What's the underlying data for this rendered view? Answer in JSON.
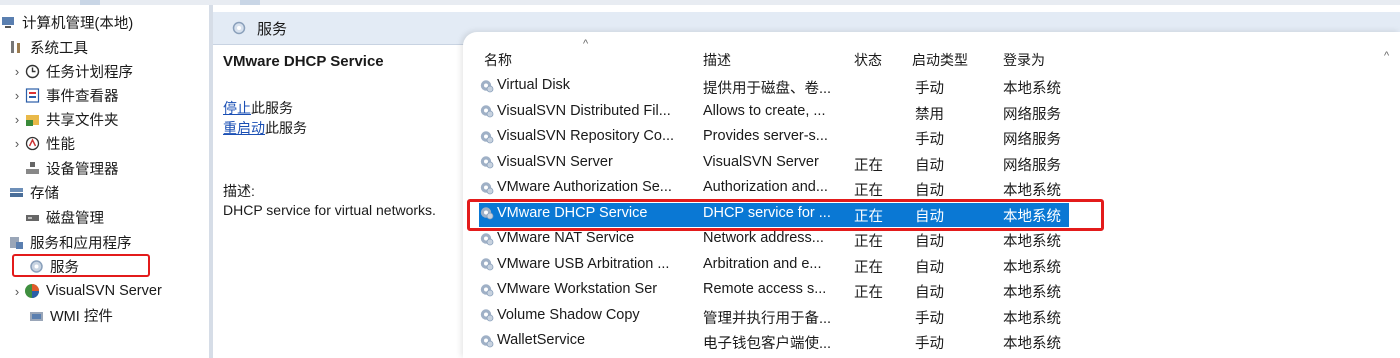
{
  "tree": {
    "root": "计算机管理(本地)",
    "system_tools": "系统工具",
    "task_scheduler": "任务计划程序",
    "event_viewer": "事件查看器",
    "shared_folders": "共享文件夹",
    "performance": "性能",
    "device_manager": "设备管理器",
    "storage": "存储",
    "disk_management": "磁盘管理",
    "services_apps": "服务和应用程序",
    "services": "服务",
    "visualsvn_server": "VisualSVN Server",
    "wmi_control": "WMI 控件"
  },
  "header": {
    "title": "服务"
  },
  "ext": {
    "service_title": "VMware DHCP Service",
    "stop_link": "停止",
    "stop_suffix": "此服务",
    "restart_link": "重启动",
    "restart_suffix": "此服务",
    "desc_label": "描述:",
    "desc_text": "DHCP service for virtual networks."
  },
  "columns": {
    "name": "名称",
    "desc": "描述",
    "status": "状态",
    "startup": "启动类型",
    "logon": "登录为"
  },
  "services": [
    {
      "name": "Virtual Disk",
      "desc": "提供用于磁盘、卷...",
      "status": "",
      "startup": "手动",
      "logon": "本地系统"
    },
    {
      "name": "VisualSVN Distributed Fil...",
      "desc": "Allows to create, ...",
      "status": "",
      "startup": "禁用",
      "logon": "网络服务"
    },
    {
      "name": "VisualSVN Repository Co...",
      "desc": "Provides server-s...",
      "status": "",
      "startup": "手动",
      "logon": "网络服务"
    },
    {
      "name": "VisualSVN Server",
      "desc": "VisualSVN Server",
      "status": "正在",
      "startup": "自动",
      "logon": "网络服务"
    },
    {
      "name": "VMware Authorization Se...",
      "desc": "Authorization and...",
      "status": "正在",
      "startup": "自动",
      "logon": "本地系统"
    },
    {
      "name": "VMware DHCP Service",
      "desc": "DHCP service for ...",
      "status": "正在",
      "startup": "自动",
      "logon": "本地系统"
    },
    {
      "name": "VMware NAT Service",
      "desc": "Network address...",
      "status": "正在",
      "startup": "自动",
      "logon": "本地系统"
    },
    {
      "name": "VMware USB Arbitration ...",
      "desc": "Arbitration and e...",
      "status": "正在",
      "startup": "自动",
      "logon": "本地系统"
    },
    {
      "name": "VMware Workstation Ser",
      "desc": "Remote access s...",
      "status": "正在",
      "startup": "自动",
      "logon": "本地系统"
    },
    {
      "name": "Volume Shadow Copy",
      "desc": "管理并执行用于备...",
      "status": "",
      "startup": "手动",
      "logon": "本地系统"
    },
    {
      "name": "WalletService",
      "desc": "电子钱包客户端使...",
      "status": "",
      "startup": "手动",
      "logon": "本地系统"
    }
  ],
  "selected_index": 5,
  "colors": {
    "selection": "#0a78d4",
    "highlight_box": "#e31b1b",
    "header_bg": "#e3ebf5"
  }
}
